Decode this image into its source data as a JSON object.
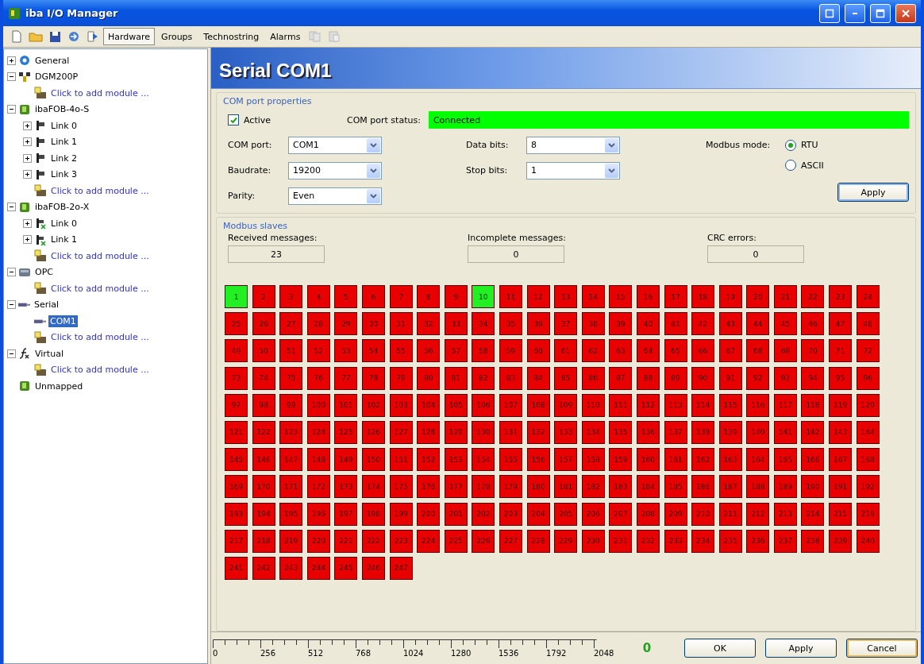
{
  "window": {
    "title": "iba I/O Manager"
  },
  "toolbar": {
    "tabs": [
      {
        "label": "Hardware",
        "selected": true
      },
      {
        "label": "Groups",
        "selected": false
      },
      {
        "label": "Technostring",
        "selected": false
      },
      {
        "label": "Alarms",
        "selected": false
      }
    ]
  },
  "tree": [
    {
      "label": "General",
      "kind": "general",
      "expanded": false,
      "selected": false
    },
    {
      "label": "DGM200P",
      "kind": "device",
      "expanded": true,
      "selected": false,
      "children": [
        {
          "label": "Click to add module ...",
          "kind": "add",
          "selected": false
        }
      ]
    },
    {
      "label": "ibaFOB-4o-S",
      "kind": "card",
      "expanded": true,
      "selected": false,
      "children": [
        {
          "label": "Link 0",
          "kind": "link",
          "expanded": false,
          "selected": false
        },
        {
          "label": "Link 1",
          "kind": "link",
          "expanded": false,
          "selected": false
        },
        {
          "label": "Link 2",
          "kind": "link",
          "expanded": false,
          "selected": false
        },
        {
          "label": "Link 3",
          "kind": "link",
          "expanded": false,
          "selected": false
        },
        {
          "label": "Click to add module ...",
          "kind": "add",
          "selected": false
        }
      ]
    },
    {
      "label": "ibaFOB-2o-X",
      "kind": "card",
      "expanded": true,
      "selected": false,
      "children": [
        {
          "label": "Link 0",
          "kind": "linkx",
          "expanded": false,
          "selected": false
        },
        {
          "label": "Link 1",
          "kind": "linkx",
          "expanded": false,
          "selected": false
        },
        {
          "label": "Click to add module ...",
          "kind": "add",
          "selected": false
        }
      ]
    },
    {
      "label": "OPC",
      "kind": "opc",
      "expanded": true,
      "selected": false,
      "children": [
        {
          "label": "Click to add module ...",
          "kind": "add",
          "selected": false
        }
      ]
    },
    {
      "label": "Serial",
      "kind": "serial",
      "expanded": true,
      "selected": false,
      "children": [
        {
          "label": "COM1",
          "kind": "serial",
          "selected": true
        },
        {
          "label": "Click to add module ...",
          "kind": "add",
          "selected": false
        }
      ]
    },
    {
      "label": "Virtual",
      "kind": "virtual",
      "expanded": true,
      "selected": false,
      "children": [
        {
          "label": "Click to add module ...",
          "kind": "add",
          "selected": false
        }
      ]
    },
    {
      "label": "Unmapped",
      "kind": "card",
      "selected": false
    }
  ],
  "header": {
    "title": "Serial COM1"
  },
  "properties": {
    "title": "COM port properties",
    "active": {
      "label": "Active",
      "checked": true
    },
    "status": {
      "label": "COM port status:",
      "value": "Connected",
      "connected": true
    },
    "left_fields": [
      {
        "label": "COM port:",
        "value": "COM1"
      },
      {
        "label": "Baudrate:",
        "value": "19200"
      },
      {
        "label": "Parity:",
        "value": "Even"
      }
    ],
    "middle_fields": [
      {
        "label": "Data bits:",
        "value": "8"
      },
      {
        "label": "Stop bits:",
        "value": "1"
      }
    ],
    "modbus_mode": {
      "label": "Modbus mode:",
      "options": [
        {
          "label": "RTU",
          "selected": true
        },
        {
          "label": "ASCII",
          "selected": false
        }
      ]
    },
    "apply_button": "Apply"
  },
  "slaves": {
    "title": "Modbus slaves",
    "counters": [
      {
        "label": "Received messages:",
        "value": "23"
      },
      {
        "label": "Incomplete messages:",
        "value": "0"
      },
      {
        "label": "CRC errors:",
        "value": "0"
      }
    ],
    "items": [
      {
        "label": "1",
        "ok": true
      },
      {
        "label": "2",
        "ok": false
      },
      {
        "label": "3",
        "ok": false
      },
      {
        "label": "4",
        "ok": false
      },
      {
        "label": "5",
        "ok": false
      },
      {
        "label": "6",
        "ok": false
      },
      {
        "label": "7",
        "ok": false
      },
      {
        "label": "8",
        "ok": false
      },
      {
        "label": "9",
        "ok": false
      },
      {
        "label": "10",
        "ok": true
      },
      {
        "label": "11",
        "ok": false
      },
      {
        "label": "12",
        "ok": false
      },
      {
        "label": "13",
        "ok": false
      },
      {
        "label": "14",
        "ok": false
      },
      {
        "label": "15",
        "ok": false
      },
      {
        "label": "16",
        "ok": false
      },
      {
        "label": "17",
        "ok": false
      },
      {
        "label": "18",
        "ok": false
      },
      {
        "label": "19",
        "ok": false
      },
      {
        "label": "20",
        "ok": false
      },
      {
        "label": "21",
        "ok": false
      },
      {
        "label": "22",
        "ok": false
      },
      {
        "label": "23",
        "ok": false
      },
      {
        "label": "24",
        "ok": false
      },
      {
        "label": "25",
        "ok": false
      },
      {
        "label": "26",
        "ok": false
      },
      {
        "label": "27",
        "ok": false
      },
      {
        "label": "28",
        "ok": false
      },
      {
        "label": "29",
        "ok": false
      },
      {
        "label": "30",
        "ok": false
      },
      {
        "label": "31",
        "ok": false
      },
      {
        "label": "32",
        "ok": false
      },
      {
        "label": "33",
        "ok": false
      },
      {
        "label": "34",
        "ok": false
      },
      {
        "label": "35",
        "ok": false
      },
      {
        "label": "36",
        "ok": false
      },
      {
        "label": "37",
        "ok": false
      },
      {
        "label": "38",
        "ok": false
      },
      {
        "label": "39",
        "ok": false
      },
      {
        "label": "40",
        "ok": false
      },
      {
        "label": "41",
        "ok": false
      },
      {
        "label": "42",
        "ok": false
      },
      {
        "label": "43",
        "ok": false
      },
      {
        "label": "44",
        "ok": false
      },
      {
        "label": "45",
        "ok": false
      },
      {
        "label": "46",
        "ok": false
      },
      {
        "label": "47",
        "ok": false
      },
      {
        "label": "48",
        "ok": false
      },
      {
        "label": "49",
        "ok": false
      },
      {
        "label": "50",
        "ok": false
      },
      {
        "label": "51",
        "ok": false
      },
      {
        "label": "52",
        "ok": false
      },
      {
        "label": "53",
        "ok": false
      },
      {
        "label": "54",
        "ok": false
      },
      {
        "label": "55",
        "ok": false
      },
      {
        "label": "56",
        "ok": false
      },
      {
        "label": "57",
        "ok": false
      },
      {
        "label": "58",
        "ok": false
      },
      {
        "label": "59",
        "ok": false
      },
      {
        "label": "60",
        "ok": false
      },
      {
        "label": "61",
        "ok": false
      },
      {
        "label": "62",
        "ok": false
      },
      {
        "label": "63",
        "ok": false
      },
      {
        "label": "64",
        "ok": false
      },
      {
        "label": "65",
        "ok": false
      },
      {
        "label": "66",
        "ok": false
      },
      {
        "label": "67",
        "ok": false
      },
      {
        "label": "68",
        "ok": false
      },
      {
        "label": "69",
        "ok": false
      },
      {
        "label": "70",
        "ok": false
      },
      {
        "label": "71",
        "ok": false
      },
      {
        "label": "72",
        "ok": false
      },
      {
        "label": "73",
        "ok": false
      },
      {
        "label": "74",
        "ok": false
      },
      {
        "label": "75",
        "ok": false
      },
      {
        "label": "76",
        "ok": false
      },
      {
        "label": "77",
        "ok": false
      },
      {
        "label": "78",
        "ok": false
      },
      {
        "label": "79",
        "ok": false
      },
      {
        "label": "80",
        "ok": false
      },
      {
        "label": "81",
        "ok": false
      },
      {
        "label": "82",
        "ok": false
      },
      {
        "label": "83",
        "ok": false
      },
      {
        "label": "84",
        "ok": false
      },
      {
        "label": "85",
        "ok": false
      },
      {
        "label": "86",
        "ok": false
      },
      {
        "label": "87",
        "ok": false
      },
      {
        "label": "88",
        "ok": false
      },
      {
        "label": "89",
        "ok": false
      },
      {
        "label": "90",
        "ok": false
      },
      {
        "label": "91",
        "ok": false
      },
      {
        "label": "92",
        "ok": false
      },
      {
        "label": "93",
        "ok": false
      },
      {
        "label": "94",
        "ok": false
      },
      {
        "label": "95",
        "ok": false
      },
      {
        "label": "96",
        "ok": false
      },
      {
        "label": "97",
        "ok": false
      },
      {
        "label": "98",
        "ok": false
      },
      {
        "label": "99",
        "ok": false
      },
      {
        "label": "100",
        "ok": false
      },
      {
        "label": "101",
        "ok": false
      },
      {
        "label": "102",
        "ok": false
      },
      {
        "label": "103",
        "ok": false
      },
      {
        "label": "104",
        "ok": false
      },
      {
        "label": "105",
        "ok": false
      },
      {
        "label": "106",
        "ok": false
      },
      {
        "label": "107",
        "ok": false
      },
      {
        "label": "108",
        "ok": false
      },
      {
        "label": "109",
        "ok": false
      },
      {
        "label": "110",
        "ok": false
      },
      {
        "label": "111",
        "ok": false
      },
      {
        "label": "112",
        "ok": false
      },
      {
        "label": "113",
        "ok": false
      },
      {
        "label": "114",
        "ok": false
      },
      {
        "label": "115",
        "ok": false
      },
      {
        "label": "116",
        "ok": false
      },
      {
        "label": "117",
        "ok": false
      },
      {
        "label": "118",
        "ok": false
      },
      {
        "label": "119",
        "ok": false
      },
      {
        "label": "120",
        "ok": false
      },
      {
        "label": "121",
        "ok": false
      },
      {
        "label": "122",
        "ok": false
      },
      {
        "label": "123",
        "ok": false
      },
      {
        "label": "124",
        "ok": false
      },
      {
        "label": "125",
        "ok": false
      },
      {
        "label": "126",
        "ok": false
      },
      {
        "label": "127",
        "ok": false
      },
      {
        "label": "128",
        "ok": false
      },
      {
        "label": "129",
        "ok": false
      },
      {
        "label": "130",
        "ok": false
      },
      {
        "label": "131",
        "ok": false
      },
      {
        "label": "132",
        "ok": false
      },
      {
        "label": "133",
        "ok": false
      },
      {
        "label": "134",
        "ok": false
      },
      {
        "label": "135",
        "ok": false
      },
      {
        "label": "136",
        "ok": false
      },
      {
        "label": "137",
        "ok": false
      },
      {
        "label": "138",
        "ok": false
      },
      {
        "label": "139",
        "ok": false
      },
      {
        "label": "140",
        "ok": false
      },
      {
        "label": "141",
        "ok": false
      },
      {
        "label": "142",
        "ok": false
      },
      {
        "label": "143",
        "ok": false
      },
      {
        "label": "144",
        "ok": false
      },
      {
        "label": "145",
        "ok": false
      },
      {
        "label": "146",
        "ok": false
      },
      {
        "label": "147",
        "ok": false
      },
      {
        "label": "148",
        "ok": false
      },
      {
        "label": "149",
        "ok": false
      },
      {
        "label": "150",
        "ok": false
      },
      {
        "label": "151",
        "ok": false
      },
      {
        "label": "152",
        "ok": false
      },
      {
        "label": "153",
        "ok": false
      },
      {
        "label": "154",
        "ok": false
      },
      {
        "label": "155",
        "ok": false
      },
      {
        "label": "156",
        "ok": false
      },
      {
        "label": "157",
        "ok": false
      },
      {
        "label": "158",
        "ok": false
      },
      {
        "label": "159",
        "ok": false
      },
      {
        "label": "160",
        "ok": false
      },
      {
        "label": "161",
        "ok": false
      },
      {
        "label": "162",
        "ok": false
      },
      {
        "label": "163",
        "ok": false
      },
      {
        "label": "164",
        "ok": false
      },
      {
        "label": "165",
        "ok": false
      },
      {
        "label": "166",
        "ok": false
      },
      {
        "label": "167",
        "ok": false
      },
      {
        "label": "168",
        "ok": false
      },
      {
        "label": "169",
        "ok": false
      },
      {
        "label": "170",
        "ok": false
      },
      {
        "label": "171",
        "ok": false
      },
      {
        "label": "172",
        "ok": false
      },
      {
        "label": "173",
        "ok": false
      },
      {
        "label": "174",
        "ok": false
      },
      {
        "label": "175",
        "ok": false
      },
      {
        "label": "176",
        "ok": false
      },
      {
        "label": "177",
        "ok": false
      },
      {
        "label": "178",
        "ok": false
      },
      {
        "label": "179",
        "ok": false
      },
      {
        "label": "180",
        "ok": false
      },
      {
        "label": "181",
        "ok": false
      },
      {
        "label": "182",
        "ok": false
      },
      {
        "label": "183",
        "ok": false
      },
      {
        "label": "184",
        "ok": false
      },
      {
        "label": "185",
        "ok": false
      },
      {
        "label": "186",
        "ok": false
      },
      {
        "label": "187",
        "ok": false
      },
      {
        "label": "188",
        "ok": false
      },
      {
        "label": "189",
        "ok": false
      },
      {
        "label": "190",
        "ok": false
      },
      {
        "label": "191",
        "ok": false
      },
      {
        "label": "192",
        "ok": false
      },
      {
        "label": "193",
        "ok": false
      },
      {
        "label": "194",
        "ok": false
      },
      {
        "label": "195",
        "ok": false
      },
      {
        "label": "196",
        "ok": false
      },
      {
        "label": "197",
        "ok": false
      },
      {
        "label": "198",
        "ok": false
      },
      {
        "label": "199",
        "ok": false
      },
      {
        "label": "200",
        "ok": false
      },
      {
        "label": "201",
        "ok": false
      },
      {
        "label": "202",
        "ok": false
      },
      {
        "label": "203",
        "ok": false
      },
      {
        "label": "204",
        "ok": false
      },
      {
        "label": "205",
        "ok": false
      },
      {
        "label": "206",
        "ok": false
      },
      {
        "label": "207",
        "ok": false
      },
      {
        "label": "208",
        "ok": false
      },
      {
        "label": "209",
        "ok": false
      },
      {
        "label": "210",
        "ok": false
      },
      {
        "label": "211",
        "ok": false
      },
      {
        "label": "212",
        "ok": false
      },
      {
        "label": "213",
        "ok": false
      },
      {
        "label": "214",
        "ok": false
      },
      {
        "label": "215",
        "ok": false
      },
      {
        "label": "216",
        "ok": false
      },
      {
        "label": "217",
        "ok": false
      },
      {
        "label": "218",
        "ok": false
      },
      {
        "label": "219",
        "ok": false
      },
      {
        "label": "220",
        "ok": false
      },
      {
        "label": "221",
        "ok": false
      },
      {
        "label": "222",
        "ok": false
      },
      {
        "label": "223",
        "ok": false
      },
      {
        "label": "224",
        "ok": false
      },
      {
        "label": "225",
        "ok": false
      },
      {
        "label": "226",
        "ok": false
      },
      {
        "label": "227",
        "ok": false
      },
      {
        "label": "228",
        "ok": false
      },
      {
        "label": "229",
        "ok": false
      },
      {
        "label": "230",
        "ok": false
      },
      {
        "label": "231",
        "ok": false
      },
      {
        "label": "232",
        "ok": false
      },
      {
        "label": "233",
        "ok": false
      },
      {
        "label": "234",
        "ok": false
      },
      {
        "label": "235",
        "ok": false
      },
      {
        "label": "236",
        "ok": false
      },
      {
        "label": "237",
        "ok": false
      },
      {
        "label": "238",
        "ok": false
      },
      {
        "label": "239",
        "ok": false
      },
      {
        "label": "240",
        "ok": false
      },
      {
        "label": "241",
        "ok": false
      },
      {
        "label": "242",
        "ok": false
      },
      {
        "label": "243",
        "ok": false
      },
      {
        "label": "244",
        "ok": false
      },
      {
        "label": "245",
        "ok": false
      },
      {
        "label": "246",
        "ok": false
      },
      {
        "label": "247",
        "ok": false
      }
    ]
  },
  "bottom_bar": {
    "ruler_labels": [
      "0",
      "256",
      "512",
      "768",
      "1024",
      "1280",
      "1536",
      "1792",
      "2048"
    ],
    "count": "0",
    "buttons": [
      {
        "label": "OK",
        "hovered": false
      },
      {
        "label": "Apply",
        "hovered": false
      },
      {
        "label": "Cancel",
        "hovered": true
      }
    ]
  }
}
